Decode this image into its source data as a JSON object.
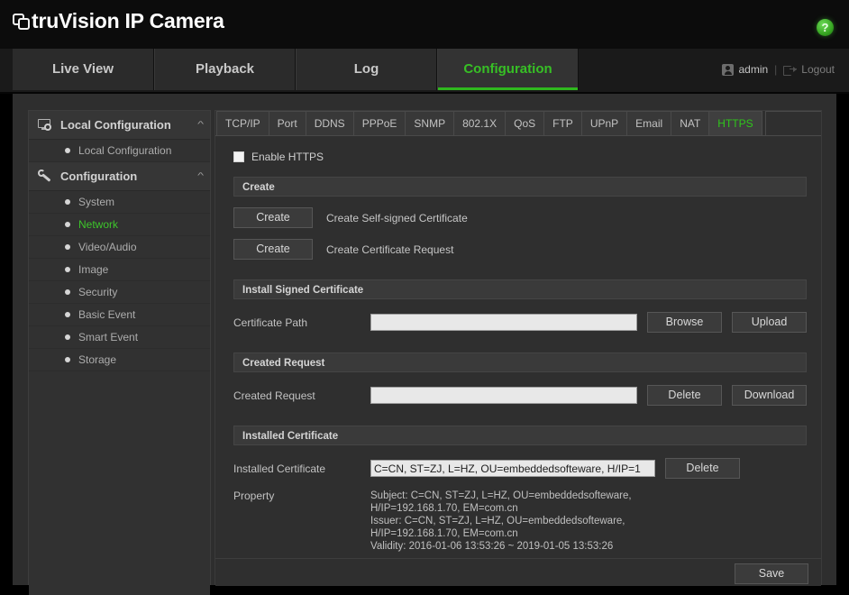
{
  "brand": {
    "name_bold": "truVision",
    "name_rest": "IP Camera",
    "logo_icon": "overlapping-squares-logo",
    "help_icon": "?"
  },
  "topnav": {
    "tabs": [
      {
        "label": "Live View",
        "active": false
      },
      {
        "label": "Playback",
        "active": false
      },
      {
        "label": "Log",
        "active": false
      },
      {
        "label": "Configuration",
        "active": true
      }
    ],
    "user": "admin",
    "separator": "|",
    "logout": "Logout",
    "user_icon": "person-icon",
    "logout_icon": "logout-arrow-icon",
    "active_color": "#37c025"
  },
  "sidebar": {
    "groups": [
      {
        "title": "Local Configuration",
        "icon": "monitor-gear-icon",
        "chevron": "^",
        "items": [
          {
            "label": "Local Configuration",
            "selected": false
          }
        ]
      },
      {
        "title": "Configuration",
        "icon": "wrench-icon",
        "chevron": "^",
        "items": [
          {
            "label": "System",
            "selected": false
          },
          {
            "label": "Network",
            "selected": true
          },
          {
            "label": "Video/Audio",
            "selected": false
          },
          {
            "label": "Image",
            "selected": false
          },
          {
            "label": "Security",
            "selected": false
          },
          {
            "label": "Basic Event",
            "selected": false
          },
          {
            "label": "Smart Event",
            "selected": false
          },
          {
            "label": "Storage",
            "selected": false
          }
        ]
      }
    ]
  },
  "content": {
    "subtabs": [
      {
        "label": "TCP/IP",
        "active": false
      },
      {
        "label": "Port",
        "active": false
      },
      {
        "label": "DDNS",
        "active": false
      },
      {
        "label": "PPPoE",
        "active": false
      },
      {
        "label": "SNMP",
        "active": false
      },
      {
        "label": "802.1X",
        "active": false
      },
      {
        "label": "QoS",
        "active": false
      },
      {
        "label": "FTP",
        "active": false
      },
      {
        "label": "UPnP",
        "active": false
      },
      {
        "label": "Email",
        "active": false
      },
      {
        "label": "NAT",
        "active": false
      },
      {
        "label": "HTTPS",
        "active": true
      }
    ],
    "enable_https": {
      "label": "Enable  HTTPS",
      "checked": false
    },
    "create_section": {
      "heading": "Create",
      "rows": [
        {
          "button": "Create",
          "label": "Create Self-signed Certificate"
        },
        {
          "button": "Create",
          "label": "Create Certificate Request"
        }
      ]
    },
    "install_section": {
      "heading": "Install Signed Certificate",
      "field_label": "Certificate Path",
      "field_value": "",
      "field_placeholder": "",
      "browse_button": "Browse",
      "upload_button": "Upload"
    },
    "created_request_section": {
      "heading": "Created Request",
      "field_label": "Created Request",
      "field_value": "",
      "field_placeholder": "",
      "delete_button": "Delete",
      "download_button": "Download"
    },
    "installed_certificate_section": {
      "heading": "Installed Certificate",
      "field_label": "Installed Certificate",
      "field_value": "C=CN, ST=ZJ, L=HZ, OU=embeddedsofteware, H/IP=1",
      "delete_button": "Delete",
      "property_label": "Property",
      "property_lines": [
        "Subject: C=CN, ST=ZJ, L=HZ, OU=embeddedsofteware,",
        "H/IP=192.168.1.70, EM=com.cn",
        "Issuer: C=CN, ST=ZJ, L=HZ, OU=embeddedsofteware,",
        "H/IP=192.168.1.70, EM=com.cn",
        "Validity: 2016-01-06 13:53:26 ~ 2019-01-05 13:53:26"
      ]
    },
    "save_button": "Save"
  }
}
